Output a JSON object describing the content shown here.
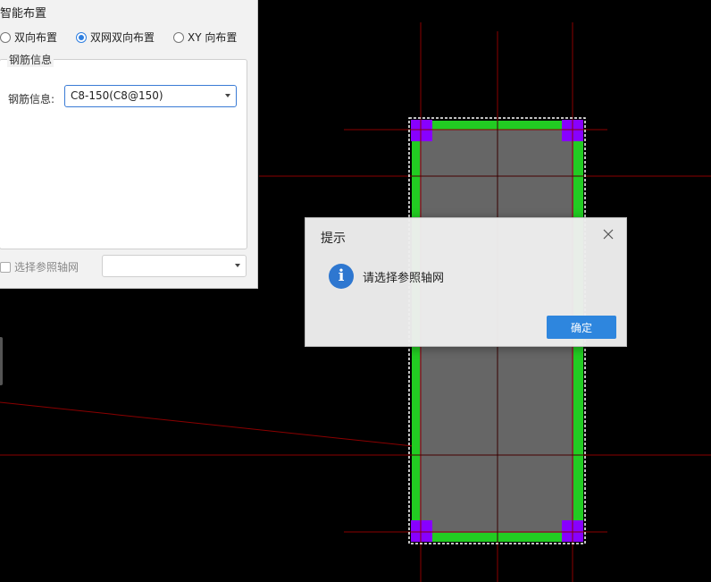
{
  "panel": {
    "title": "智能布置",
    "layout_modes": [
      {
        "label": "双向布置",
        "checked": false
      },
      {
        "label": "双网双向布置",
        "checked": true
      },
      {
        "label": "XY 向布置",
        "checked": false
      }
    ],
    "rebar_group": {
      "legend": "钢筋信息",
      "field_label": "钢筋信息:",
      "selected_value": "C8-150(C8@150)"
    },
    "reference_grid": {
      "label": "选择参照轴网",
      "checked": false,
      "selected_value": ""
    }
  },
  "dialog": {
    "title": "提示",
    "message": "请选择参照轴网",
    "ok_label": "确定",
    "icon": "info-icon"
  },
  "colors": {
    "canvas_bg": "#000000",
    "axis_line": "#8b0000",
    "slab_fill": "#666666",
    "slab_border": "#22cc22",
    "corner_marker": "#8800ff",
    "accent": "#2e86de"
  }
}
